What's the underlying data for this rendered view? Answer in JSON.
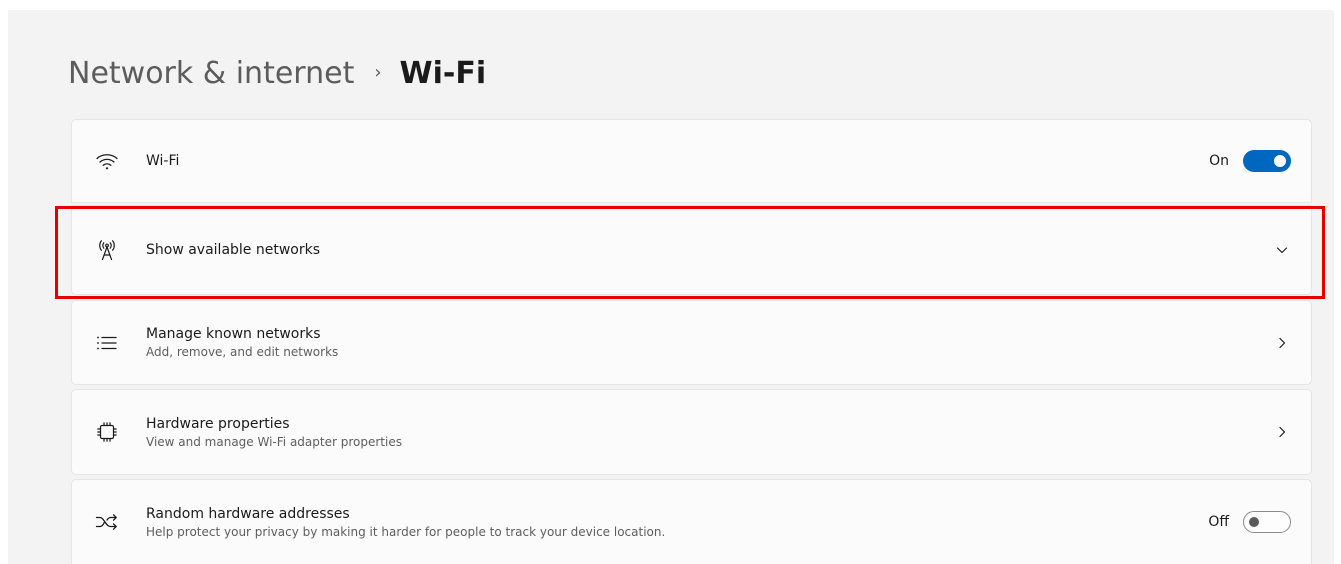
{
  "breadcrumb": {
    "parent": "Network & internet",
    "separator": "›",
    "current": "Wi-Fi"
  },
  "rows": [
    {
      "id": "wifi",
      "icon": "wifi-icon",
      "title": "Wi-Fi",
      "state_label": "On",
      "toggle_on": true
    },
    {
      "id": "show-networks",
      "icon": "antenna-icon",
      "title": "Show available networks",
      "control": "chevron-down-icon"
    },
    {
      "id": "manage-known",
      "icon": "list-icon",
      "title": "Manage known networks",
      "subtitle": "Add, remove, and edit networks",
      "control": "chevron-right-icon"
    },
    {
      "id": "hardware-properties",
      "icon": "chip-icon",
      "title": "Hardware properties",
      "subtitle": "View and manage Wi-Fi adapter properties",
      "control": "chevron-right-icon"
    },
    {
      "id": "random-hw-addresses",
      "icon": "shuffle-icon",
      "title": "Random hardware addresses",
      "subtitle": "Help protect your privacy by making it harder for people to track your device location.",
      "state_label": "Off",
      "toggle_on": false
    }
  ],
  "colors": {
    "accent": "#0067c0",
    "highlight_border": "#e60000",
    "panel_background": "#f3f3f3",
    "card_background": "#fbfbfb"
  }
}
